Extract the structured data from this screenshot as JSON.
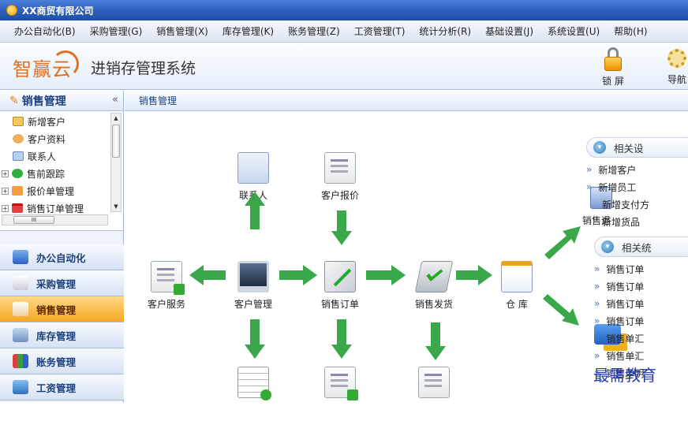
{
  "window": {
    "title": "XX商贸有限公司"
  },
  "menu": {
    "items": [
      {
        "label": "办公自动化(B)"
      },
      {
        "label": "采购管理(G)"
      },
      {
        "label": "销售管理(X)"
      },
      {
        "label": "库存管理(K)"
      },
      {
        "label": "账务管理(Z)"
      },
      {
        "label": "工资管理(T)"
      },
      {
        "label": "统计分析(R)"
      },
      {
        "label": "基础设置(J)"
      },
      {
        "label": "系统设置(U)"
      },
      {
        "label": "帮助(H)"
      }
    ]
  },
  "brand": {
    "logo_text": "智赢云",
    "system_title": "进销存管理系统",
    "lock_label": "锁 屏",
    "nav_label": "导航"
  },
  "sidebar": {
    "title": "销售管理",
    "collapse_glyph": "«",
    "tree": [
      {
        "label": "新增客户",
        "icon": "card-icon"
      },
      {
        "label": "客户资料",
        "icon": "person-icon"
      },
      {
        "label": "联系人",
        "icon": "contact-icon"
      },
      {
        "label": "售前跟踪",
        "icon": "check-icon",
        "expander": "+"
      },
      {
        "label": "报价单管理",
        "icon": "pen-icon",
        "expander": "+"
      },
      {
        "label": "销售订单管理",
        "icon": "calendar-icon",
        "expander": "+"
      }
    ],
    "hscroll_thumb": "III",
    "modules": [
      {
        "label": "办公自动化",
        "icon": "monitor-icon"
      },
      {
        "label": "采购管理",
        "icon": "pen-icon"
      },
      {
        "label": "销售管理",
        "icon": "pen-icon",
        "active": true
      },
      {
        "label": "库存管理",
        "icon": "arrows-icon"
      },
      {
        "label": "账务管理",
        "icon": "chart-icon"
      },
      {
        "label": "工资管理",
        "icon": "payroll-icon"
      }
    ]
  },
  "main": {
    "breadcrumb": "销售管理",
    "flow": {
      "nodes": {
        "contact": "联系人",
        "quote": "客户报价",
        "service": "客户服务",
        "customer": "客户管理",
        "order": "销售订单",
        "shipping": "销售发货",
        "warehouse": "仓 库",
        "return": "销售退"
      }
    },
    "related_settings": {
      "title": "相关设",
      "links": [
        "新增客户",
        "新增员工",
        "新增支付方",
        "新增货品"
      ]
    },
    "related_reports": {
      "title": "相关统",
      "links": [
        "销售订单",
        "销售订单",
        "销售订单",
        "销售订单",
        "销售单汇",
        "销售单汇",
        "销售单明"
      ]
    }
  },
  "watermark": "最需教育"
}
